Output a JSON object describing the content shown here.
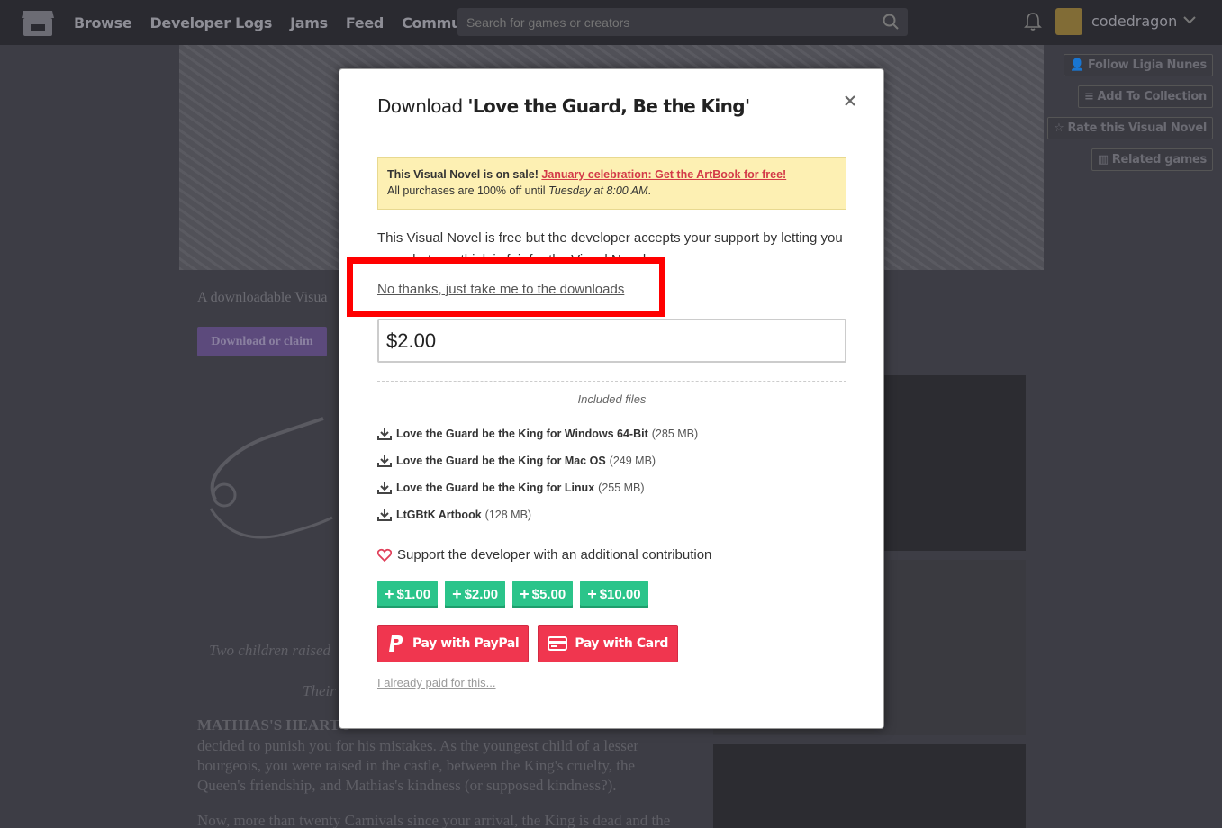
{
  "nav": {
    "links": [
      "Browse",
      "Developer Logs",
      "Jams",
      "Feed",
      "Community"
    ],
    "search_placeholder": "Search for games or creators",
    "username": "codedragon"
  },
  "sidebar_actions": [
    "Follow Ligia Nunes",
    "Add To Collection",
    "Rate this Visual Novel",
    "Related games"
  ],
  "page": {
    "tagline": "A downloadable Visua",
    "download_claim": "Download or claim",
    "italic_line_1": "Two children raised",
    "italic_line_2": "Their",
    "heading": "MATHIAS'S HEART I",
    "body_lines": [
      "decided to punish you for his mistakes. As the youngest child of a lesser",
      "bourgeois, you were raised in the castle, between the King's cruelty, the",
      "Queen's friendship, and Mathias's kindness (or supposed kindness?).",
      "Now, more than twenty Carnivals since your arrival, the King is dead and the"
    ]
  },
  "modal": {
    "title_prefix": "Download ",
    "title_name": "'Love the Guard, Be the King'",
    "sale_bold": "This Visual Novel is on sale!",
    "sale_link": "January celebration: Get the ArtBook for free!",
    "sale_line2_prefix": "All purchases are 100% off until ",
    "sale_line2_time": "Tuesday at 8:00 AM",
    "sale_line2_suffix": ".",
    "free_text": "This Visual Novel is free but the developer accepts your support by letting you pay what you think is fair for the Visual Novel.",
    "no_thanks": "No thanks, just take me to the downloads",
    "price_value": "$2.00",
    "included_files_label": "Included files",
    "files": [
      {
        "name": "Love the Guard be the King for Windows 64-Bit",
        "size": "(285 MB)"
      },
      {
        "name": "Love the Guard be the King for Mac OS",
        "size": "(249 MB)"
      },
      {
        "name": "Love the Guard be the King for Linux",
        "size": "(255 MB)"
      },
      {
        "name": "LtGBtK Artbook",
        "size": "(128 MB)"
      }
    ],
    "support_text": "Support the developer with an additional contribution",
    "tips": [
      "$1.00",
      "$2.00",
      "$5.00",
      "$10.00"
    ],
    "pay_paypal": "Pay with PayPal",
    "pay_card": "Pay with Card",
    "already_paid": "I already paid for this..."
  },
  "colors": {
    "highlight_box": "#ff0000",
    "tip_green": "#2bc48a",
    "pay_red": "#f0364f",
    "sale_bg": "#fdf0b3"
  }
}
